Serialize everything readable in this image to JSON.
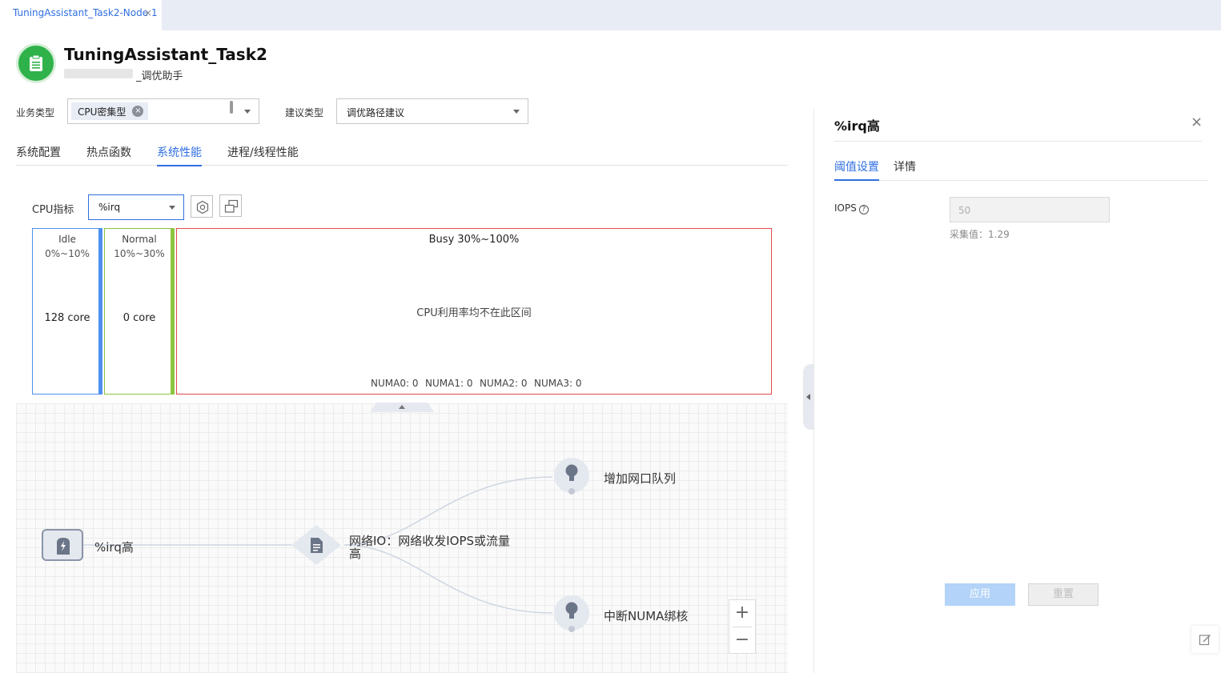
{
  "tabbar": {
    "tab_label": "TuningAssistant_Task2-Node 1",
    "close_glyph": "×"
  },
  "header": {
    "title": "TuningAssistant_Task2",
    "subtitle": "_调优助手",
    "logo_icon": "clipboard-icon",
    "logo_color": "#2fb24a"
  },
  "filters": {
    "business_type_label": "业务类型",
    "business_type_chip": "CPU密集型",
    "chip_remove_glyph": "×",
    "suggestion_type_label": "建议类型",
    "suggestion_type_value": "调优路径建议"
  },
  "nav": {
    "tabs": [
      "系统配置",
      "热点函数",
      "系统性能",
      "进程/线程性能"
    ],
    "active": "系统性能"
  },
  "metric": {
    "label": "CPU指标",
    "selected": "%irq",
    "settings_icon": "gear-icon",
    "layout_icon": "switch-view-icon"
  },
  "buckets": {
    "idle": {
      "title": "Idle",
      "range": "0%~10%",
      "count": "128 core",
      "color": "#4c8ff0"
    },
    "normal": {
      "title": "Normal",
      "range": "10%~30%",
      "count": "0 core",
      "color": "#8cc63f"
    },
    "busy": {
      "title": "Busy 30%~100%",
      "message": "CPU利用率均不在此区间",
      "color": "#e14c4c",
      "numa": [
        "NUMA0: 0",
        "NUMA1: 0",
        "NUMA2: 0",
        "NUMA3: 0"
      ]
    }
  },
  "flow": {
    "root": {
      "label": "%irq高",
      "icon": "lightning-icon"
    },
    "middle": {
      "line1": "网络IO：网络收发IOPS或流量",
      "line2": "高",
      "icon": "document-icon"
    },
    "leaves": [
      {
        "label": "增加网口队列",
        "icon": "lightbulb-icon"
      },
      {
        "label": "中断NUMA绑核",
        "icon": "lightbulb-icon"
      }
    ],
    "zoom_in": "+",
    "zoom_out": "−"
  },
  "panel": {
    "title": "%irq高",
    "close_glyph": "×",
    "tabs": [
      "阈值设置",
      "详情"
    ],
    "active_tab": "阈值设置",
    "iops_label": "IOPS",
    "help_glyph": "?",
    "iops_value": "50",
    "collected": "采集值：1.29",
    "apply_label": "应用",
    "reset_label": "重置",
    "accent_color": "#2f6fe0"
  }
}
